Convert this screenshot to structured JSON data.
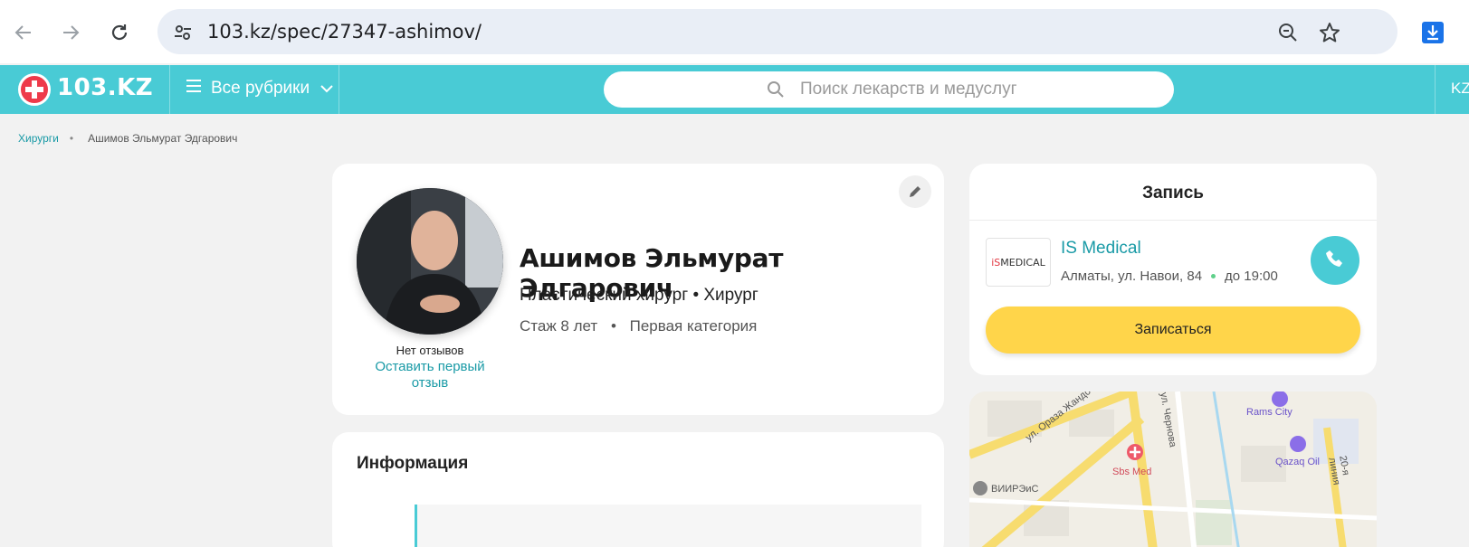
{
  "browser": {
    "url": "103.kz/spec/27347-ashimov/",
    "icons": [
      "back-arrow-icon",
      "forward-arrow-icon",
      "reload-icon",
      "site-settings-icon",
      "zoom-icon",
      "bookmark-star-icon",
      "download-icon"
    ]
  },
  "header": {
    "logo_text": "103.KZ",
    "rubrics_label": "Все рубрики",
    "search_placeholder": "Поиск лекарств и медуслуг",
    "lang_label": "KZ",
    "colors": {
      "header_bg": "#49cbd5",
      "logo_red": "#ee3a4a"
    }
  },
  "breadcrumb": {
    "items": [
      "Хирурги",
      "Ашимов Эльмурат Эдгарович"
    ]
  },
  "profile": {
    "name": "Ашимов Эльмурат Эдгарович",
    "specialties": "Пластический хирург • Хирург",
    "experience": "Стаж 8 лет",
    "category": "Первая категория",
    "reviews_status": "Нет отзывов",
    "leave_review_link": "Оставить первый отзыв"
  },
  "info_section": {
    "title": "Информация"
  },
  "booking": {
    "title": "Запись",
    "clinic_name": "IS Medical",
    "clinic_logo_text": "MEDICAL",
    "clinic_logo_prefix": "iS",
    "clinic_address": "Алматы, ул. Навои, 84",
    "clinic_hours": "до 19:00",
    "book_button": "Записаться",
    "colors": {
      "book_button": "#ffd54a",
      "accent": "#49cbd5"
    }
  },
  "map": {
    "labels": [
      "ул. Ораза Жандосова",
      "ул. Чернова",
      "Rams City",
      "Sbs Med",
      "Qazaq Oil",
      "ВИИРЭиС",
      "20-я линия"
    ]
  }
}
